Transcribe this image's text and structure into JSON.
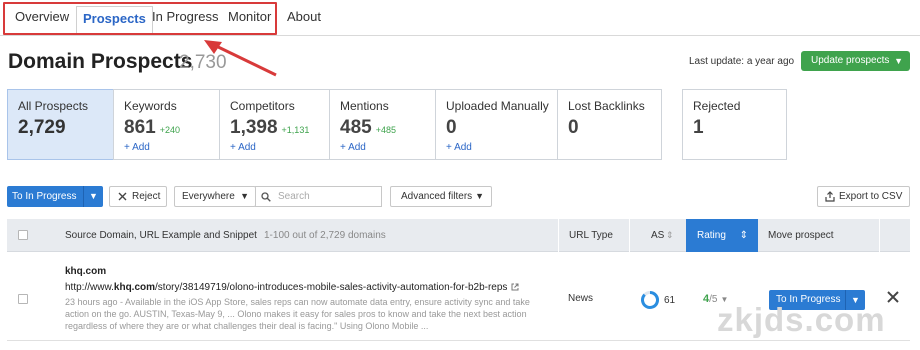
{
  "tabs": [
    {
      "label": "Overview"
    },
    {
      "label": "Prospects"
    },
    {
      "label": "In Progress"
    },
    {
      "label": "Monitor"
    },
    {
      "label": "About"
    }
  ],
  "active_tab": "Prospects",
  "header": {
    "title": "Domain Prospects",
    "count": "2,730",
    "last_update": "Last update: a year ago",
    "update_button": "Update prospects"
  },
  "cards": [
    {
      "label": "All Prospects",
      "value": "2,729",
      "delta": "",
      "add": ""
    },
    {
      "label": "Keywords",
      "value": "861",
      "delta": "+240",
      "add": "+ Add"
    },
    {
      "label": "Competitors",
      "value": "1,398",
      "delta": "+1,131",
      "add": "+ Add"
    },
    {
      "label": "Mentions",
      "value": "485",
      "delta": "+485",
      "add": "+ Add"
    },
    {
      "label": "Uploaded Manually",
      "value": "0",
      "delta": "",
      "add": "+ Add"
    },
    {
      "label": "Lost Backlinks",
      "value": "0",
      "delta": "",
      "add": ""
    },
    {
      "label": "Rejected",
      "value": "1",
      "delta": "",
      "add": ""
    }
  ],
  "toolbar": {
    "to_in_progress": "To In Progress",
    "reject": "Reject",
    "scope": "Everywhere",
    "search_placeholder": "Search",
    "advanced_filters": "Advanced filters",
    "export": "Export to CSV"
  },
  "table": {
    "col_source": "Source Domain, URL Example and Snippet",
    "range_info": "1-100 out of 2,729 domains",
    "col_url_type": "URL Type",
    "col_as": "AS",
    "col_rating": "Rating",
    "col_move": "Move prospect",
    "rows": [
      {
        "domain": "khq.com",
        "url_prefix": "http://www.",
        "url_domain": "khq.com",
        "url_path": "/story/38149719/olono-introduces-mobile-sales-activity-automation-for-b2b-reps",
        "snippet": "23 hours ago - Available in the iOS App Store, sales reps can now automate data entry, ensure activity sync and take action on the go. AUSTIN, Texas-May 9, ... Olono makes it easy for sales pros to know and take the next best action regardless of where they are or what challenges their deal is facing.\" Using Olono Mobile ...",
        "url_type": "News",
        "as": "61",
        "rating": "4",
        "rating_max": "/5",
        "move_label": "To In Progress"
      }
    ]
  },
  "watermark": "zkjds.com",
  "colors": {
    "accent_blue": "#2b7bd3",
    "green": "#3fa34d",
    "highlight_red": "#d83a3a"
  }
}
